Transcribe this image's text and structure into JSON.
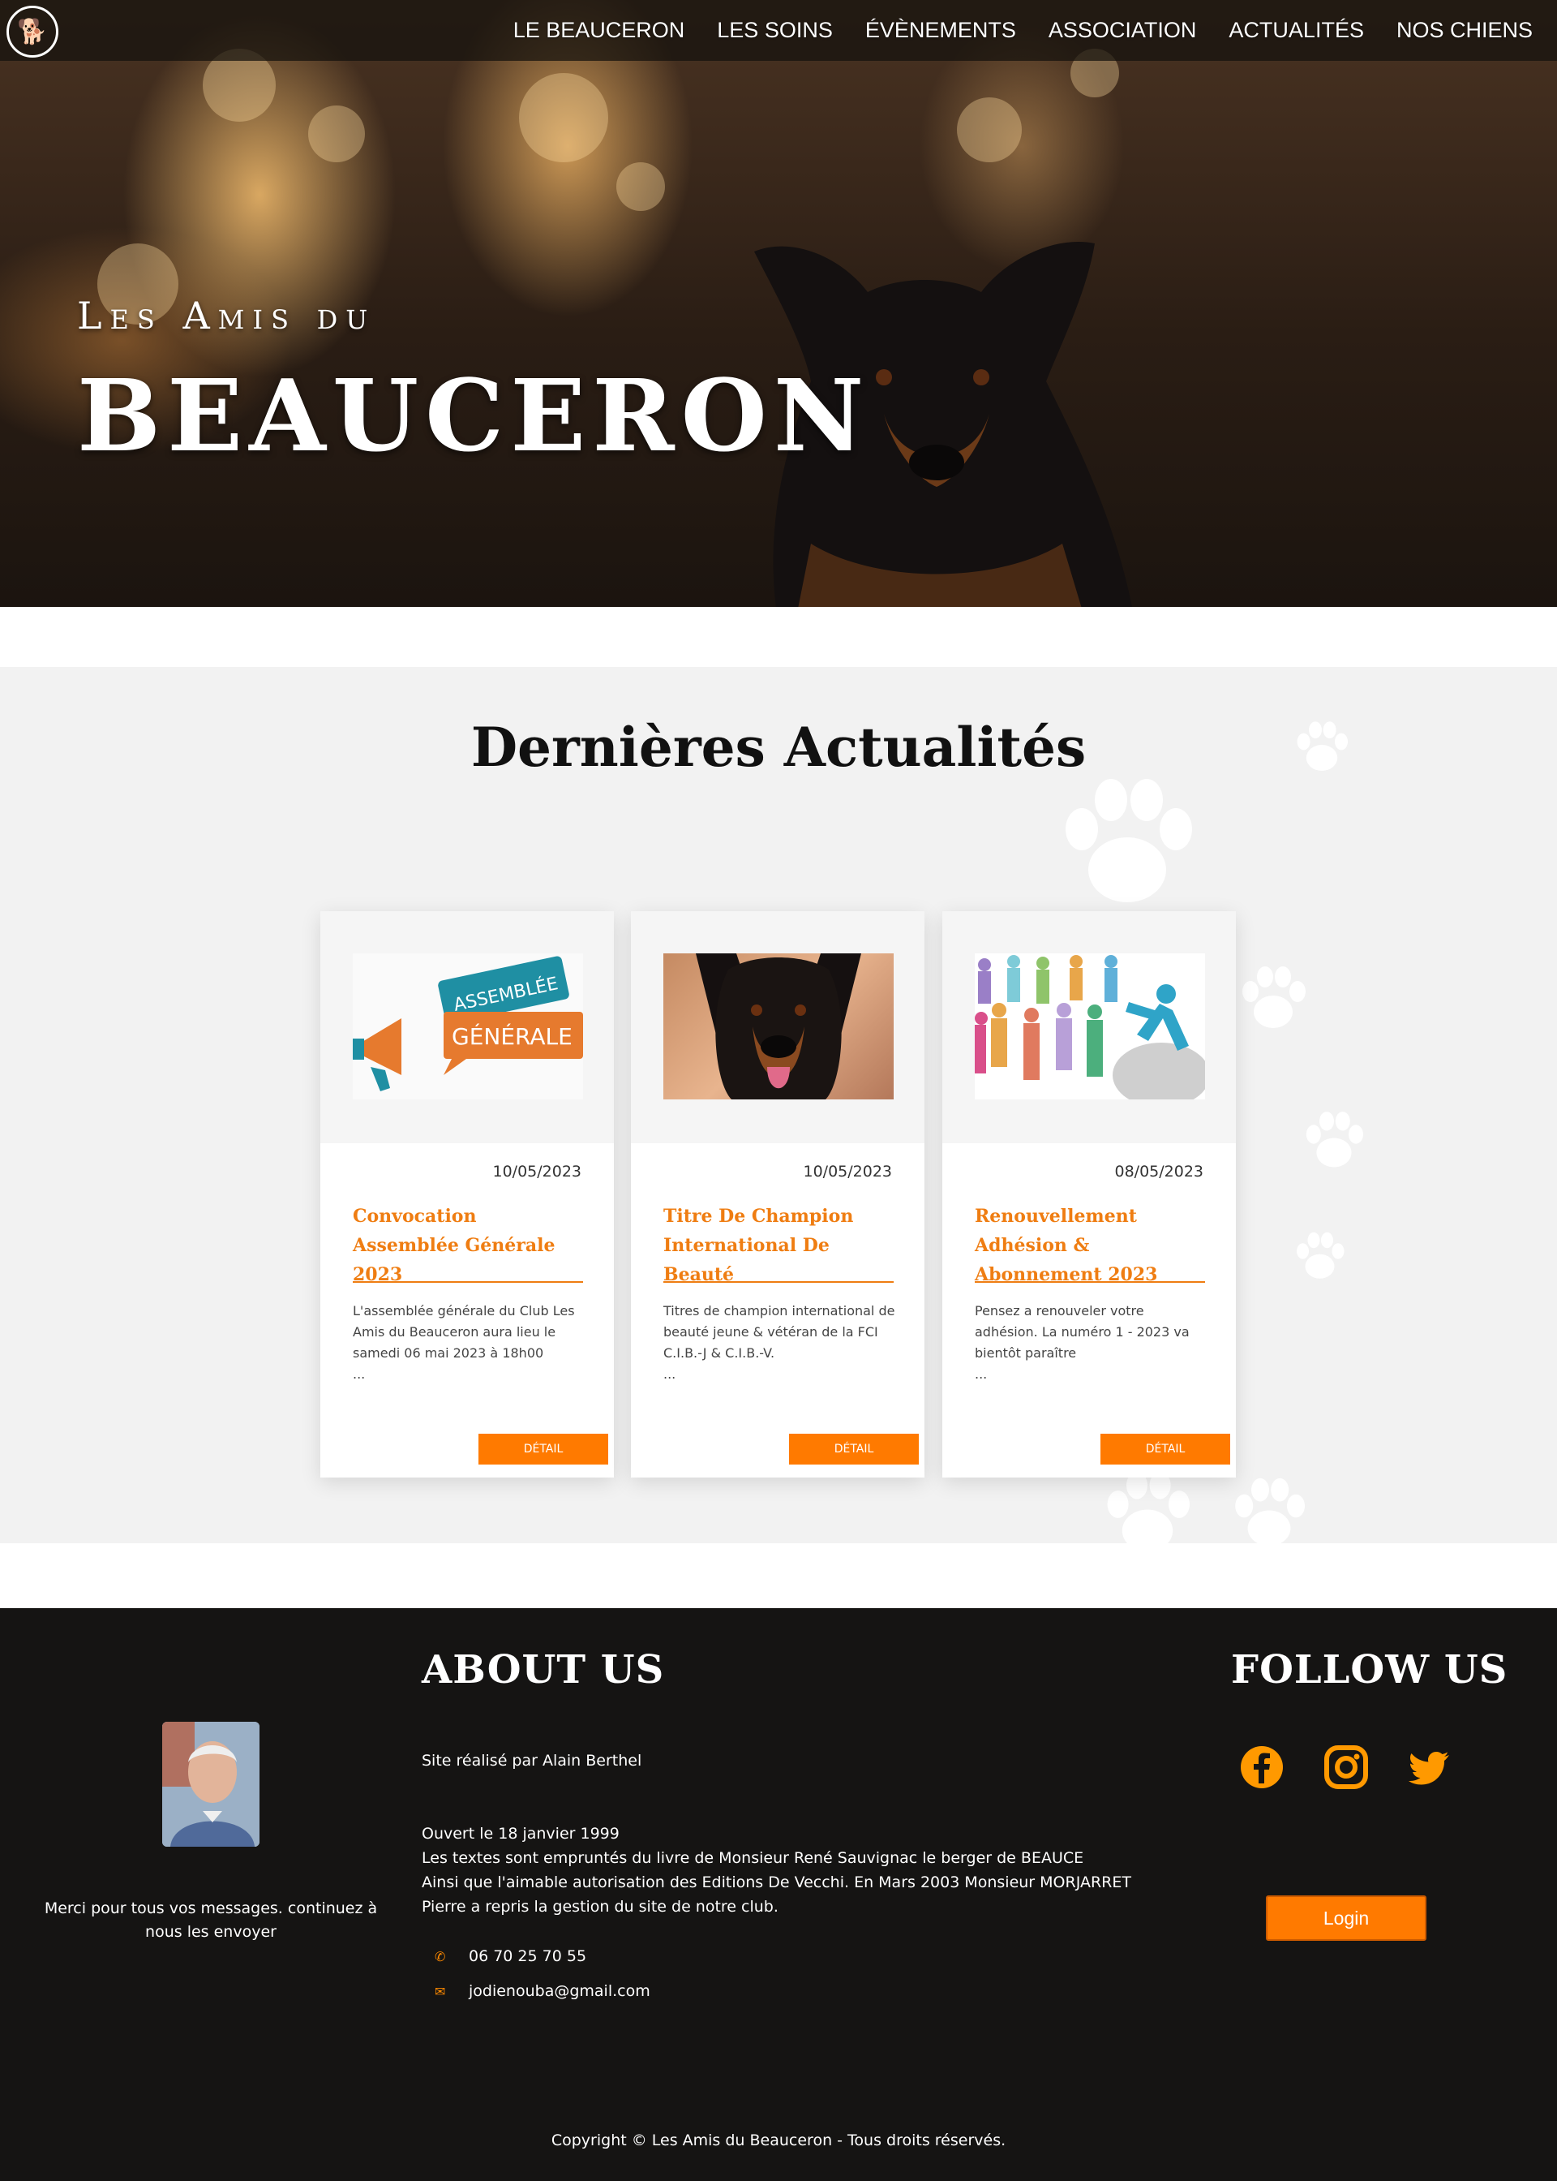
{
  "nav": {
    "logo_glyph": "🐕",
    "items": [
      {
        "label": "LE BEAUCERON"
      },
      {
        "label": "LES SOINS"
      },
      {
        "label": "ÉVÈNEMENTS"
      },
      {
        "label": "ASSOCIATION"
      },
      {
        "label": "ACTUALITÉS"
      },
      {
        "label": "NOS CHIENS"
      }
    ]
  },
  "hero": {
    "subtitle": "Les Amis du",
    "title": "BEAUCERON"
  },
  "news": {
    "title": "Dernières Actualités",
    "cards": [
      {
        "date": "10/05/2023",
        "title": "Convocation Assemblée Générale 2023",
        "excerpt": "L'assemblée générale du Club Les Amis du Beauceron aura lieu le samedi 06 mai 2023 à 18h00",
        "ellipsis": "...",
        "button": "DÉTAIL",
        "image_text_1": "ASSEMBLÉE",
        "image_text_2": "GÉNÉRALE"
      },
      {
        "date": "10/05/2023",
        "title": "Titre De Champion International De Beauté",
        "excerpt": "Titres de champion international de beauté jeune & vétéran de la FCI C.I.B.-J & C.I.B.-V.",
        "ellipsis": "...",
        "button": "DÉTAIL"
      },
      {
        "date": "08/05/2023",
        "title": "Renouvellement Adhésion & Abonnement 2023",
        "excerpt": "Pensez a renouveler votre adhésion. La numéro 1 - 2023 va bientôt paraître",
        "ellipsis": "...",
        "button": "DÉTAIL"
      }
    ]
  },
  "footer": {
    "thanks": "Merci pour tous vos messages. continuez à nous les envoyer",
    "about_title": "ABOUT US",
    "credit": "Site réalisé par Alain Berthel",
    "history": [
      "Ouvert le 18 janvier 1999",
      "Les textes sont empruntés du livre de Monsieur René Sauvignac le berger de BEAUCE",
      "Ainsi que l'aimable autorisation des Editions De Vecchi. En Mars 2003 Monsieur MORJARRET",
      "Pierre a repris la gestion du site de notre club."
    ],
    "phone": "06 70 25 70 55",
    "email": "jodienouba@gmail.com",
    "follow_title": "FOLLOW US",
    "social": [
      "facebook-icon",
      "instagram-icon",
      "twitter-icon"
    ],
    "login": "Login",
    "copyright": "Copyright © Les Amis du Beauceron - Tous droits réservés."
  },
  "colors": {
    "accent": "#ff7a00",
    "card_title": "#ef7d12",
    "footer_bg": "#151413",
    "news_bg": "#f2f2f2"
  }
}
